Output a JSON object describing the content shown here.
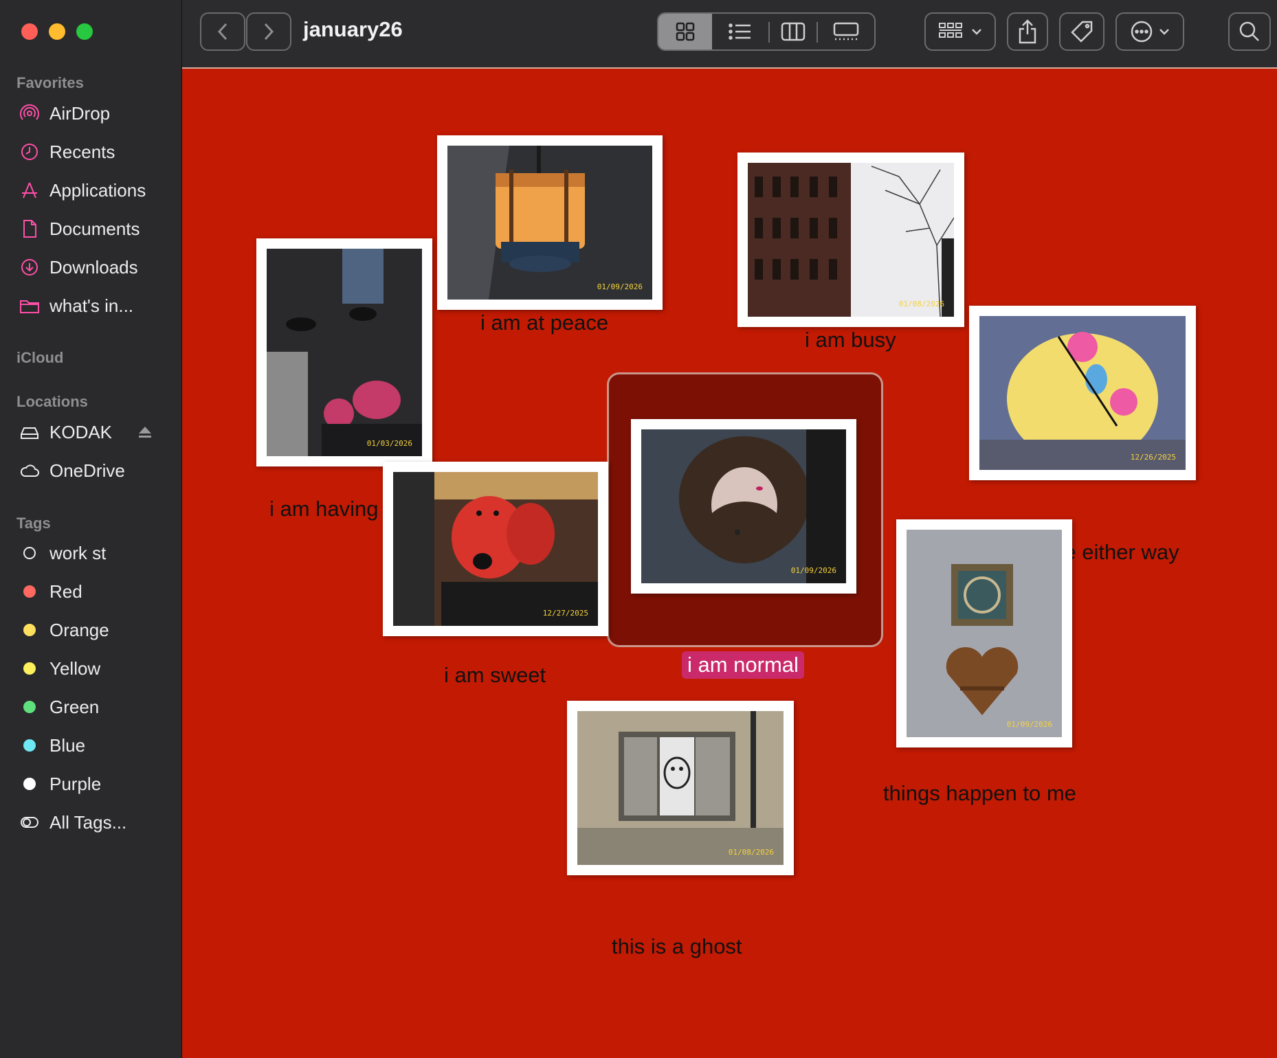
{
  "window": {
    "folder_title": "january26",
    "traffic_lights": {
      "close": "#ff5f57",
      "minimize": "#febc2e",
      "zoom": "#28c840"
    }
  },
  "sidebar": {
    "favorites_label": "Favorites",
    "favorites": [
      {
        "label": "AirDrop",
        "icon": "airdrop-icon"
      },
      {
        "label": "Recents",
        "icon": "clock-icon"
      },
      {
        "label": "Applications",
        "icon": "applications-icon"
      },
      {
        "label": "Documents",
        "icon": "document-icon"
      },
      {
        "label": "Downloads",
        "icon": "download-icon"
      },
      {
        "label": "what's in...",
        "icon": "folder-icon"
      }
    ],
    "icloud_label": "iCloud",
    "locations_label": "Locations",
    "locations": [
      {
        "label": "KODAK",
        "icon": "drive-icon"
      },
      {
        "label": "OneDrive",
        "icon": "cloud-icon"
      }
    ],
    "tags_label": "Tags",
    "tags": [
      {
        "label": "work st",
        "color": "none"
      },
      {
        "label": "Red",
        "color": "#ff6961"
      },
      {
        "label": "Orange",
        "color": "#ffdf5e"
      },
      {
        "label": "Yellow",
        "color": "#fff05c"
      },
      {
        "label": "Green",
        "color": "#5ee07c"
      },
      {
        "label": "Blue",
        "color": "#6ee8f2"
      },
      {
        "label": "Purple",
        "color": "#ffffff"
      },
      {
        "label": "All Tags...",
        "color": "all"
      }
    ],
    "accent_color": "#ff4fa8"
  },
  "toolbar": {
    "view_modes": [
      "icon-view-icon",
      "list-view-icon",
      "column-view-icon",
      "gallery-view-icon"
    ],
    "active_view": "icon-view-icon",
    "group_icon": "group-icon",
    "share_icon": "share-icon",
    "tag_icon": "tag-icon",
    "more_icon": "ellipsis-icon",
    "search_icon": "search-icon"
  },
  "canvas": {
    "background_color": "#c21a03",
    "photos": [
      {
        "caption": "i am at peace",
        "date": "01/09/2026"
      },
      {
        "caption": "i am busy",
        "date": "01/08/2026"
      },
      {
        "caption": "i am having fun",
        "date": "01/03/2026"
      },
      {
        "caption": "i am normal",
        "date": "01/09/2026",
        "selected": true
      },
      {
        "caption": "i don't care either way",
        "date": "12/26/2025"
      },
      {
        "caption": "i am sweet",
        "date": "12/27/2025"
      },
      {
        "caption": "things happen to me",
        "date": "01/09/2026"
      },
      {
        "caption": "this is a ghost",
        "date": "01/08/2026"
      }
    ]
  }
}
